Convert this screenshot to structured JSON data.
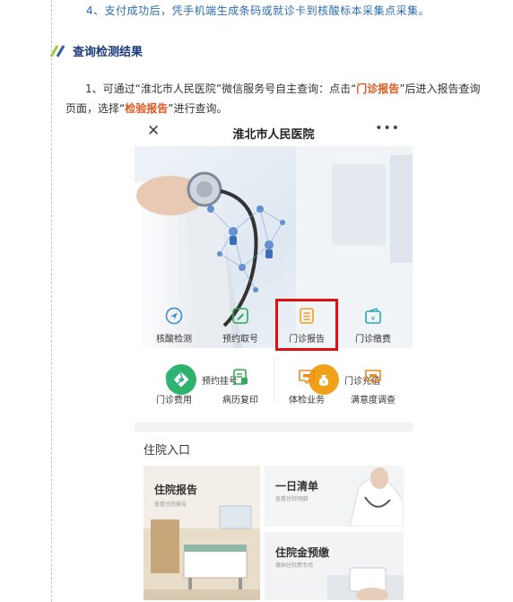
{
  "article": {
    "step4": "4、支付成功后，凭手机端生成条码或就诊卡到核酸标本采集点采集。",
    "section_title": "查询检测结果",
    "para": {
      "p1": "1、可通过“淮北市人民医院”微信服务号自主查询：点击“",
      "hl1": "门诊报告",
      "p2": "”后进入报告查询页面，选择“",
      "hl2": "检验报告",
      "p3": "”进行查询。"
    }
  },
  "phone": {
    "close": "✕",
    "title": "淮北市人民医院",
    "more": "•••",
    "big_buttons": [
      {
        "label": "预约挂号",
        "color": "#2fb36a",
        "icon": "diamond-arrow-icon"
      },
      {
        "label": "门诊充值",
        "color": "#f0a11a",
        "icon": "money-bag-icon"
      }
    ],
    "grid": [
      {
        "label": "核酸检测",
        "color": "#3a8fd8",
        "icon": "navigation-icon"
      },
      {
        "label": "预约取号",
        "color": "#31a85a",
        "icon": "edit-icon"
      },
      {
        "label": "门诊报告",
        "color": "#f0a11a",
        "icon": "document-icon"
      },
      {
        "label": "门诊缴费",
        "color": "#27a9b8",
        "icon": "wallet-icon"
      },
      {
        "label": "门诊费用",
        "color": "#2fb39a",
        "icon": "yen-circle-icon"
      },
      {
        "label": "病历复印",
        "color": "#31a85a",
        "icon": "copy-document-icon"
      },
      {
        "label": "体检业务",
        "color": "#f08a1a",
        "icon": "chat-box-icon"
      },
      {
        "label": "满意度调查",
        "color": "#f08a1a",
        "icon": "chat-box-icon"
      }
    ],
    "inpatient": {
      "title": "住院入口",
      "cards": [
        {
          "title": "住院报告",
          "sub": "查看住院报告"
        },
        {
          "title": "一日清单",
          "sub": "查看住院明细"
        },
        {
          "title": "住院金预缴",
          "sub": "缴纳住院费专用"
        }
      ]
    }
  }
}
